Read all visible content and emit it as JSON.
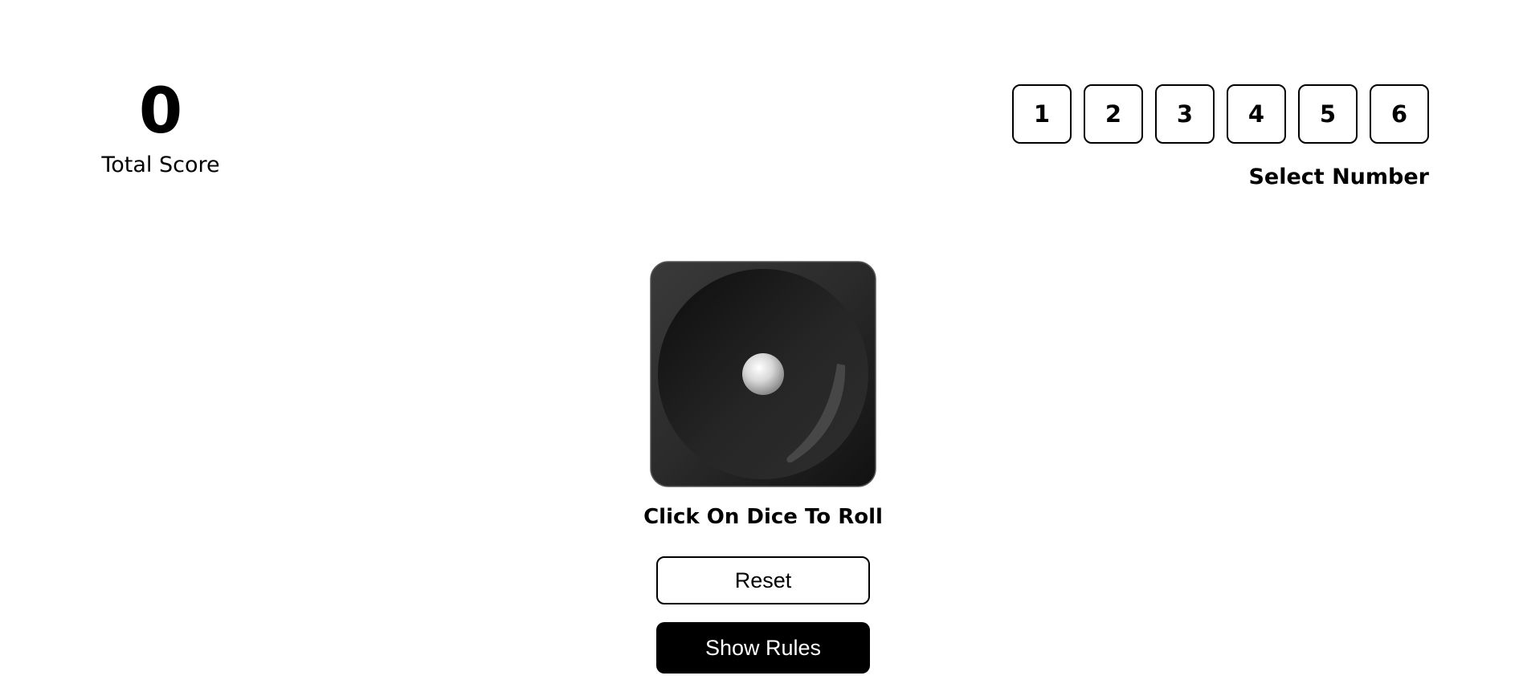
{
  "score": {
    "value": "0",
    "label": "Total Score"
  },
  "number_select": {
    "options": [
      "1",
      "2",
      "3",
      "4",
      "5",
      "6"
    ],
    "label": "Select Number"
  },
  "dice": {
    "face": 1,
    "hint": "Click On Dice To Roll"
  },
  "buttons": {
    "reset": "Reset",
    "show_rules": "Show Rules"
  },
  "colors": {
    "dice_body": "#2b2b2b",
    "primary_button": "#000000",
    "background": "#ffffff"
  }
}
